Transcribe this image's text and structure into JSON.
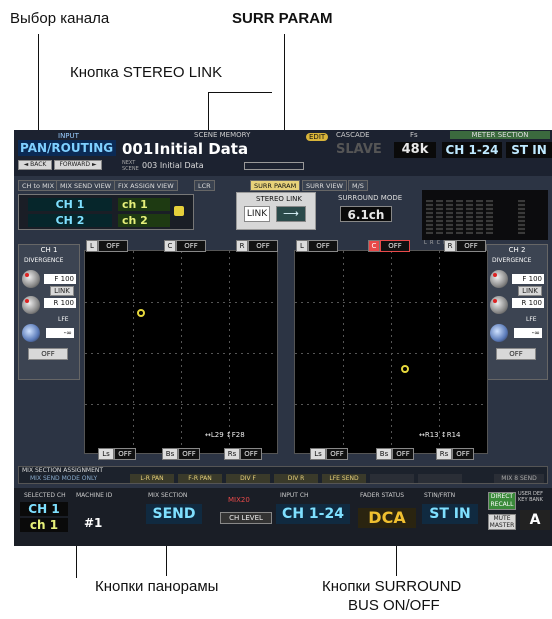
{
  "callouts": {
    "channel_select": "Выбор канала",
    "surr_param": "SURR PARAM",
    "stereo_link_button": "Кнопка STEREO LINK",
    "pan_buttons": "Кнопки панорамы",
    "surround_bus": "Кнопки SURROUND",
    "surround_bus_2": "BUS ON/OFF"
  },
  "header": {
    "input_label": "INPUT",
    "function_name": "PAN/ROUTING",
    "back": "◄ BACK",
    "forward": "FORWARD ►",
    "scene_memory_label": "SCENE MEMORY",
    "scene_number": "001",
    "scene_title": "Initial Data",
    "next_label": "NEXT SCENE",
    "next_scene": "003 Initial Data",
    "edit_badge": "EDIT",
    "cascade_label": "CASCADE",
    "cascade_value": "SLAVE",
    "fs_label": "Fs",
    "fs_value": "48k",
    "meter_section_label": "METER SECTION",
    "meter_channels": "CH 1-24",
    "meter_stin": "ST IN"
  },
  "tabs": [
    {
      "label": "CH to MIX"
    },
    {
      "label": "MIX SEND VIEW"
    },
    {
      "label": "FIX ASSIGN VIEW"
    },
    {
      "label": "LCR"
    },
    {
      "label": "SURR PARAM",
      "active": true
    },
    {
      "label": "SURR VIEW"
    },
    {
      "label": "M/S"
    }
  ],
  "channel_select": {
    "ch1_name": "CH 1",
    "ch1_short": "ch 1",
    "ch2_name": "CH 2",
    "ch2_short": "ch 2"
  },
  "stereo_link": {
    "label": "STEREO LINK",
    "link_button": "LINK",
    "arrow": "⟶"
  },
  "surround_mode": {
    "label": "SURROUND MODE",
    "value": "6.1ch"
  },
  "meter_labels": "L  R  C  Ls Lc Rs    LFE",
  "left_strip": {
    "channel": "CH 1",
    "divergence_label": "DIVERGENCE",
    "front_value": "F 100",
    "link": "LINK",
    "rear_value": "R 100",
    "lfe_label": "LFE",
    "lfe_value": "-∞",
    "lfe_off": "OFF"
  },
  "right_strip": {
    "channel": "CH 2",
    "divergence_label": "DIVERGENCE",
    "front_value": "F 100",
    "link": "LINK",
    "rear_value": "R 100",
    "lfe_label": "LFE",
    "lfe_value": "-∞",
    "lfe_off": "OFF"
  },
  "pan_left": {
    "top_l": "L",
    "top_c": "C",
    "top_r": "R",
    "off": "OFF",
    "bottom_ls": "Ls",
    "bottom_bs": "Bs",
    "bottom_rs": "Rs",
    "readout": "↔L29 ↕F28"
  },
  "pan_right": {
    "top_l": "L",
    "top_c": "C",
    "top_r": "R",
    "off": "OFF",
    "bottom_ls": "Ls",
    "bottom_bs": "Bs",
    "bottom_rs": "Rs",
    "readout": "↔R13 ↕R14"
  },
  "mix_section": {
    "label": "MIX SECTION ASSIGNMENT",
    "mode": "MIX SEND MODE ONLY",
    "slots": [
      "L-R PAN",
      "F-R PAN",
      "DIV F",
      "DIV R",
      "LFE SEND",
      "",
      "",
      "MIX 8 SEND"
    ]
  },
  "footer": {
    "selected_ch_label": "SELECTED CH",
    "selected_ch": "CH 1",
    "selected_ch_short": "ch 1",
    "machine_id_label": "MACHINE ID",
    "machine_id": "#1",
    "mix_section_label": "MIX SECTION",
    "mix_section_value": "SEND",
    "mix20": "MIX20",
    "ch_level": "CH LEVEL",
    "input_ch_label": "INPUT CH",
    "input_ch_value": "CH 1-24",
    "fader_status_label": "FADER STATUS",
    "fader_status_value": "DCA",
    "stin_label": "STIN/FRTN",
    "stin_value": "ST IN",
    "direct_recall": "DIRECT RECALL",
    "mute_master": "MUTE MASTER",
    "user_def_label": "USER DEF KEY BANK",
    "user_def_value": "A"
  }
}
